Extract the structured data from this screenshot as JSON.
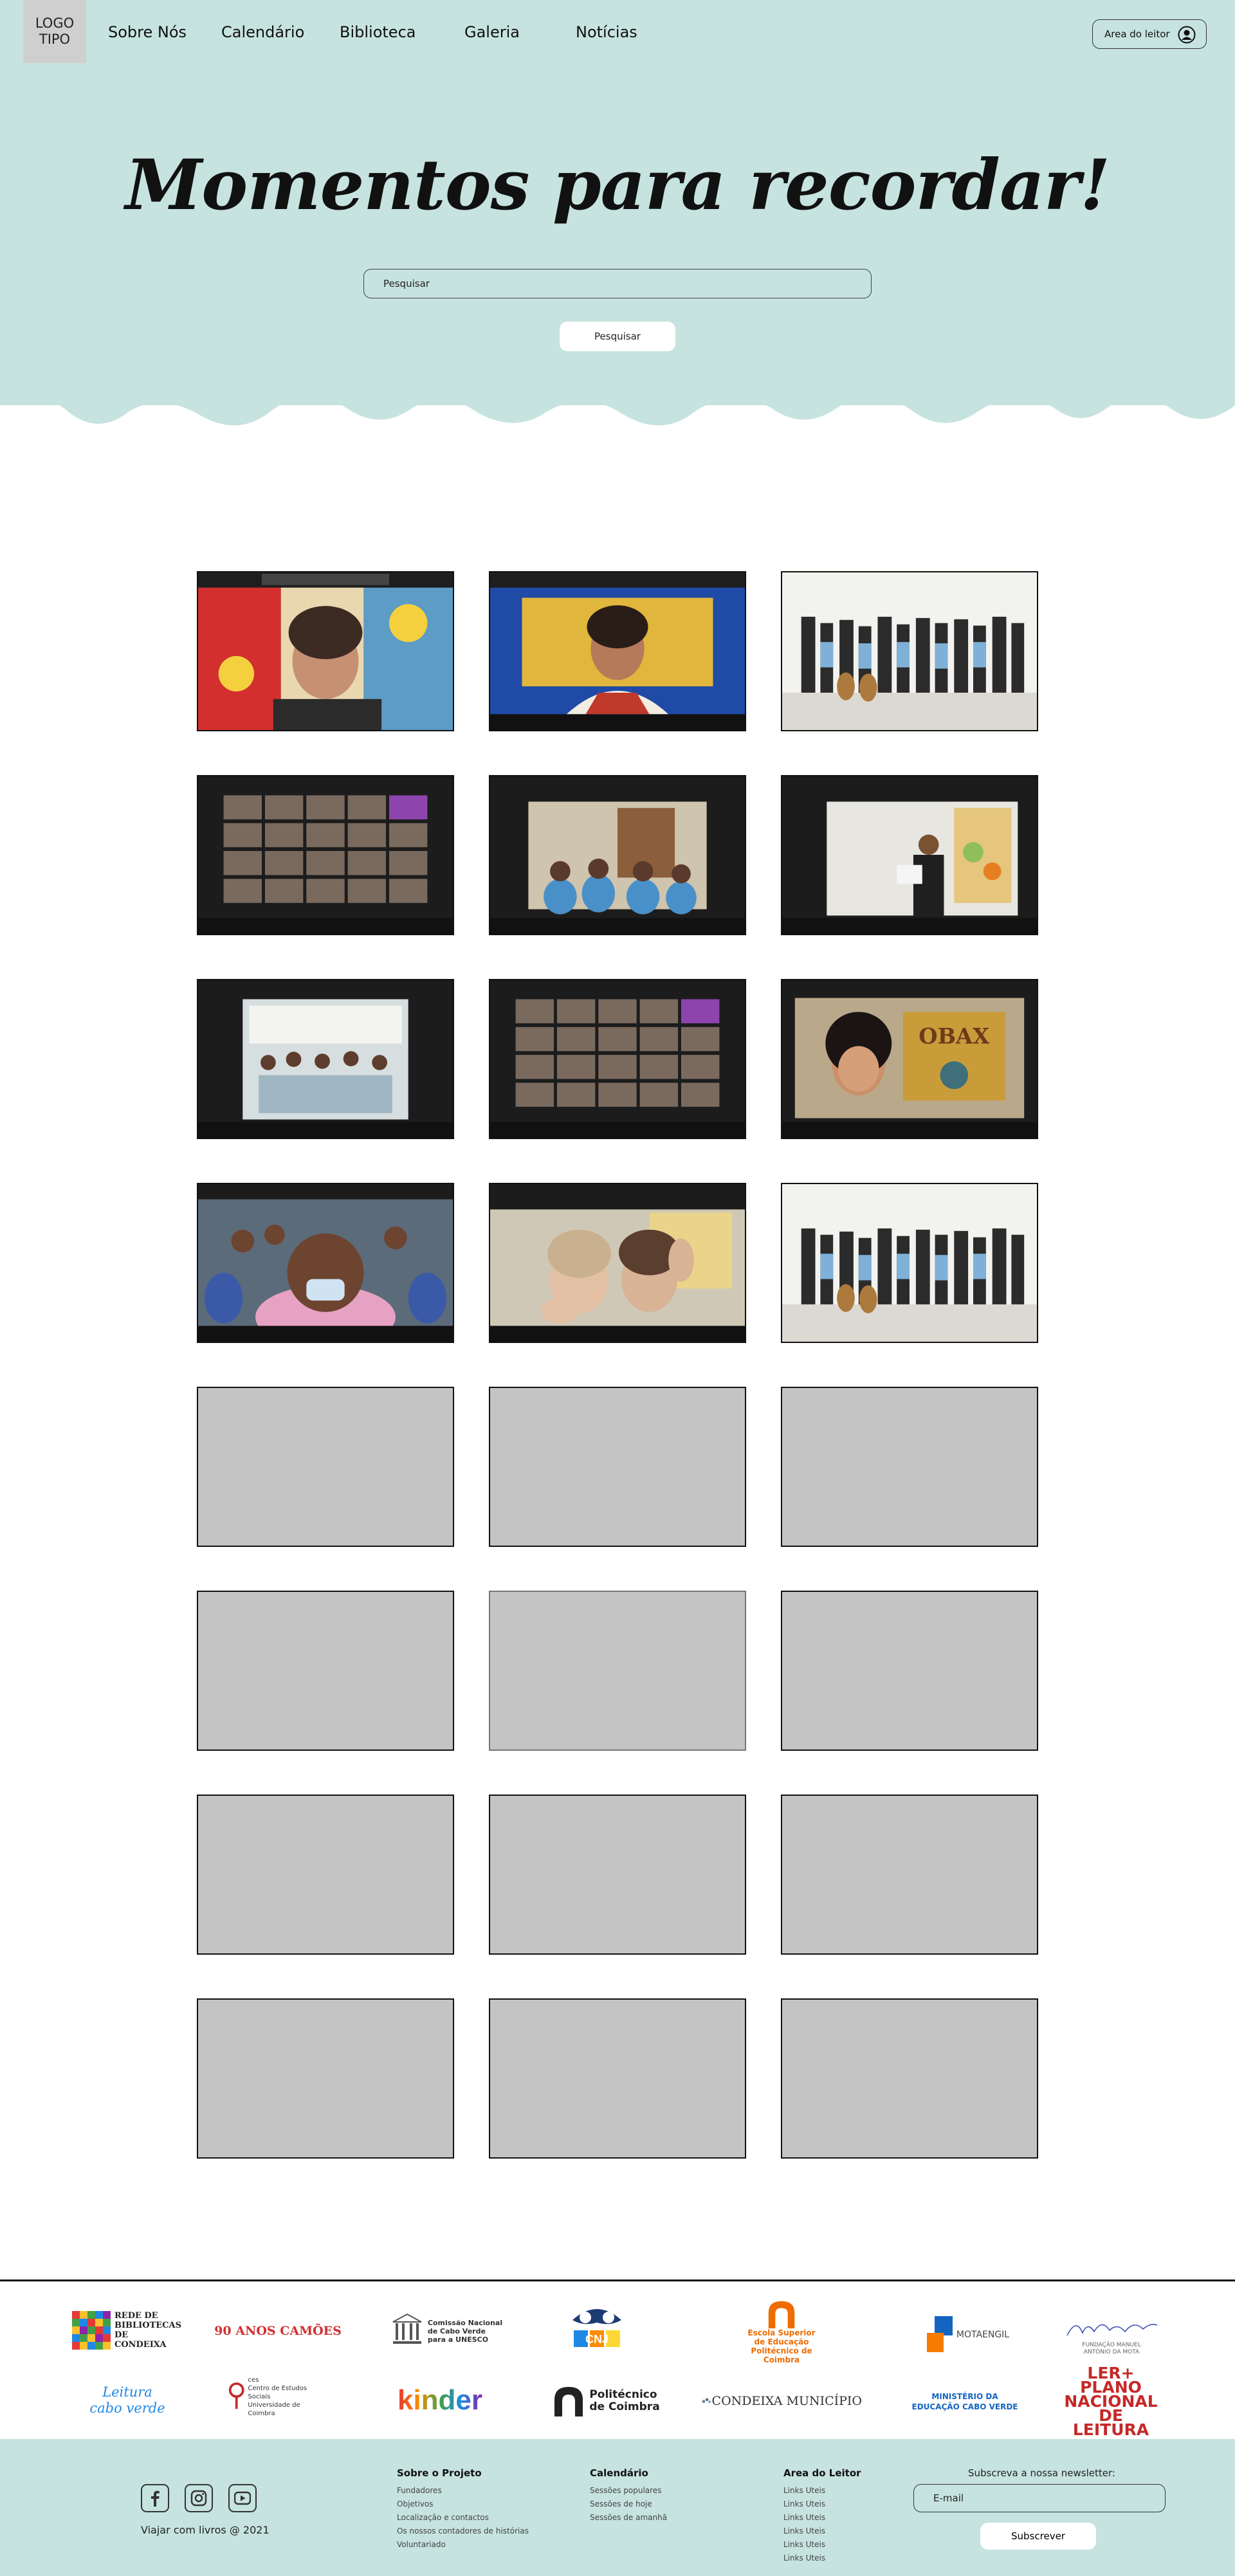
{
  "header": {
    "logo": "LOGO\nTIPO",
    "nav": [
      {
        "label": "Sobre Nós"
      },
      {
        "label": "Calendário"
      },
      {
        "label": "Biblioteca"
      },
      {
        "label": "Galeria"
      },
      {
        "label": "Notícias"
      }
    ],
    "reader_area": "Area do leitor",
    "user_icon": "user-circle-icon"
  },
  "hero": {
    "title": "Momentos para recordar!",
    "search_placeholder": "Pesquisar",
    "search_button": "Pesquisar"
  },
  "gallery": {
    "tiles": [
      {
        "kind": "photo",
        "content": "video-call-portrait-colorful-background"
      },
      {
        "kind": "photo",
        "content": "video-call-portrait-blue-yellow-wall"
      },
      {
        "kind": "photo",
        "content": "group-photo-children-guitars"
      },
      {
        "kind": "photo",
        "content": "video-call-grid-participants"
      },
      {
        "kind": "photo",
        "content": "video-call-classroom-children"
      },
      {
        "kind": "photo",
        "content": "video-call-storyteller-standing"
      },
      {
        "kind": "photo",
        "content": "video-call-classroom-wide"
      },
      {
        "kind": "photo",
        "content": "video-call-grid-participants"
      },
      {
        "kind": "photo",
        "content": "video-call-woman-holding-book"
      },
      {
        "kind": "photo",
        "content": "video-call-children-masks"
      },
      {
        "kind": "photo",
        "content": "video-call-two-women-waving"
      },
      {
        "kind": "photo",
        "content": "group-photo-children-guitars"
      },
      {
        "kind": "placeholder"
      },
      {
        "kind": "placeholder"
      },
      {
        "kind": "placeholder"
      },
      {
        "kind": "placeholder"
      },
      {
        "kind": "placeholder"
      },
      {
        "kind": "placeholder"
      },
      {
        "kind": "placeholder"
      },
      {
        "kind": "placeholder"
      },
      {
        "kind": "placeholder"
      },
      {
        "kind": "placeholder"
      },
      {
        "kind": "placeholder"
      },
      {
        "kind": "placeholder"
      }
    ]
  },
  "partners": [
    {
      "name": "Rede de Bibliotecas de Condeixa",
      "text": "REDE DE\nBIBLIOTECAS\nDE CONDEIXA"
    },
    {
      "name": "90 anos Camões",
      "text": "90 ANOS  CAMÕES"
    },
    {
      "name": "Comissão Nacional de Cabo Verde UNESCO",
      "text": "Comissão Nacional\nde Cabo Verde\npara a UNESCO"
    },
    {
      "name": "CNJ",
      "text": "CNJ"
    },
    {
      "name": "Escola Superior de Educação",
      "text": "Escola Superior\nde Educação\nPolitécnico de Coimbra"
    },
    {
      "name": "Mota-Engil",
      "text": "MOTAENGIL"
    },
    {
      "name": "Fundação Manuel António da Mota",
      "text": "FUNDAÇÃO MANUEL\nANTÓNIO DA MOTA"
    },
    {
      "name": "Leitura Cabo Verde",
      "text": "Leitura\ncabo verde"
    },
    {
      "name": "CES",
      "text": "ces\nCentro de Estudos Sociais\nUniversidade de Coimbra"
    },
    {
      "name": "Kinder",
      "text": "kinder"
    },
    {
      "name": "Politécnico de Coimbra",
      "text": "Politécnico\nde Coimbra"
    },
    {
      "name": "Condeixa Município",
      "text": "CONDEIXA MUNICÍPIO"
    },
    {
      "name": "Ministério da Educação Cabo Verde",
      "text": "MINISTÉRIO DA\nEDUCAÇÃO  CABO VERDE"
    },
    {
      "name": "Ler+",
      "text": "LER+\nPLANO NACIONAL DE LEITURA"
    }
  ],
  "footer": {
    "social": [
      "facebook-icon",
      "instagram-icon",
      "youtube-icon"
    ],
    "copyright": "Viajar com livros @ 2021",
    "columns": [
      {
        "title": "Sobre o Projeto",
        "links": [
          "Fundadores",
          "Objetivos",
          "Localização e contactos",
          "Os nossos contadores de histórias",
          "Voluntariado"
        ]
      },
      {
        "title": "Calendário",
        "links": [
          "Sessões populares",
          "Sessões de hoje",
          "Sessões de amanhã"
        ]
      },
      {
        "title": "Area do Leitor",
        "links": [
          "Links Uteis",
          "Links Uteis",
          "Links Uteis",
          "Links Uteis",
          "Links Uteis",
          "Links Uteis"
        ]
      }
    ],
    "newsletter_label": "Subscreva a nossa newsletter:",
    "email_placeholder": "E-mail",
    "subscribe_button": "Subscrever"
  },
  "colors": {
    "mint": "#c6e3df",
    "placeholder_grey": "#c4c4c4"
  }
}
